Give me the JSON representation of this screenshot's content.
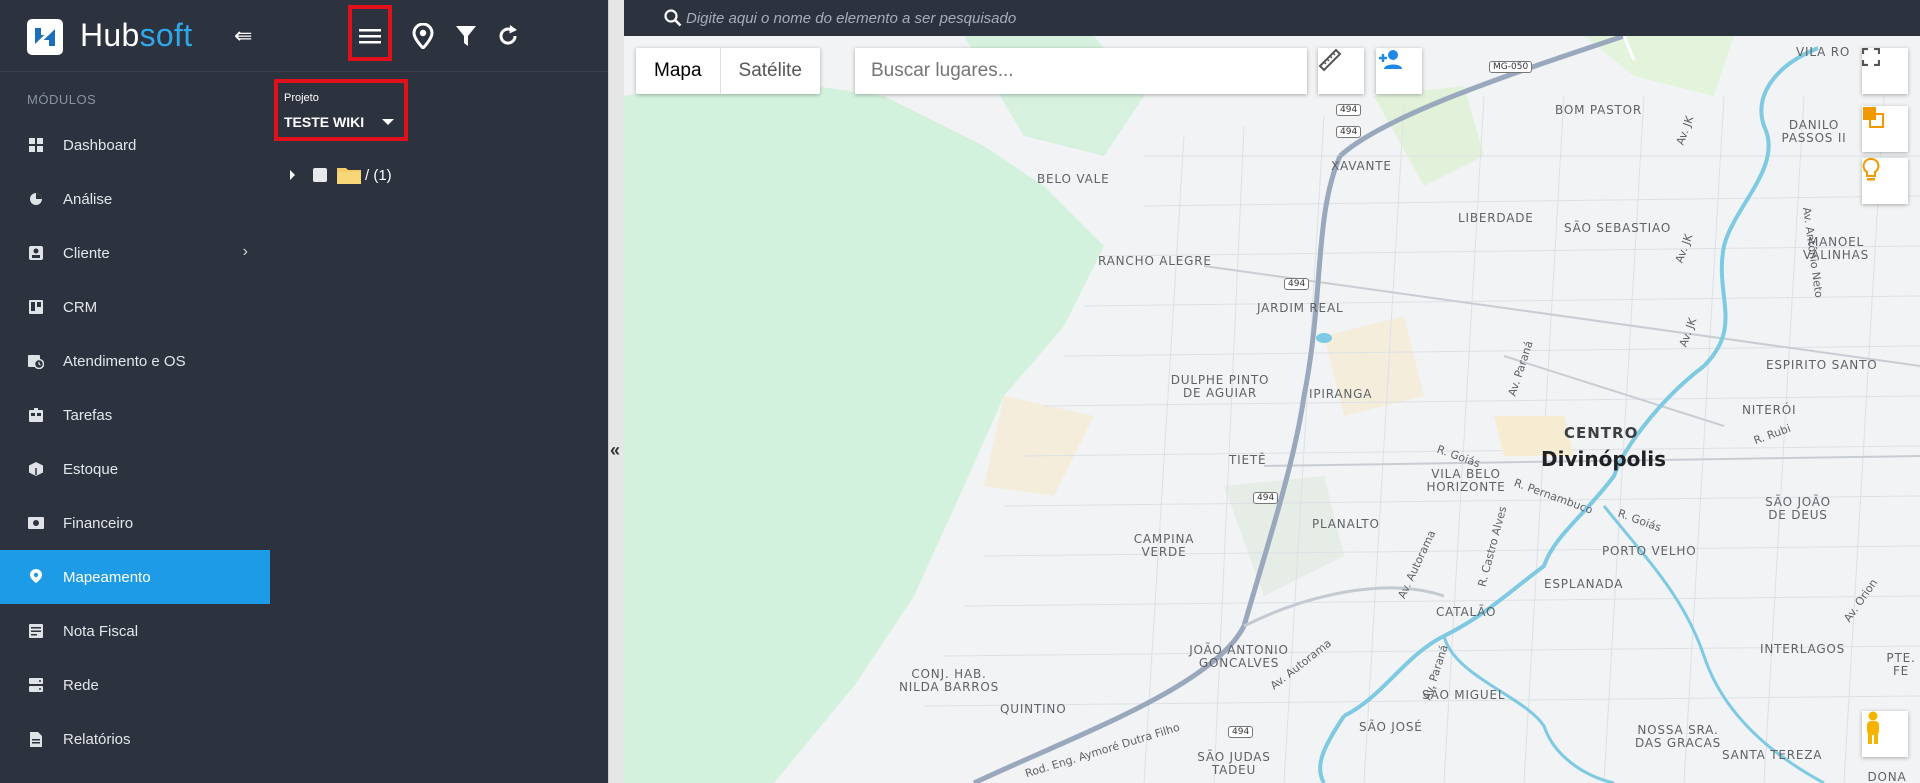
{
  "brand": {
    "hub": "Hub",
    "soft": "soft",
    "collapse_glyph": "⇚"
  },
  "sidebar": {
    "section_title": "MÓDULOS",
    "items": [
      {
        "label": "Dashboard",
        "icon": "dashboard-icon"
      },
      {
        "label": "Análise",
        "icon": "pie-chart-icon"
      },
      {
        "label": "Cliente",
        "icon": "contact-card-icon",
        "has_submenu": true
      },
      {
        "label": "CRM",
        "icon": "kanban-icon"
      },
      {
        "label": "Atendimento e OS",
        "icon": "calendar-clock-icon"
      },
      {
        "label": "Tarefas",
        "icon": "tasks-icon"
      },
      {
        "label": "Estoque",
        "icon": "box-icon"
      },
      {
        "label": "Financeiro",
        "icon": "money-icon"
      },
      {
        "label": "Mapeamento",
        "icon": "map-pin-icon",
        "active": true
      },
      {
        "label": "Nota Fiscal",
        "icon": "invoice-icon"
      },
      {
        "label": "Rede",
        "icon": "server-icon"
      },
      {
        "label": "Relatórios",
        "icon": "report-icon"
      }
    ]
  },
  "panel": {
    "toolbar": [
      "menu-icon",
      "map-marker-icon",
      "filter-icon",
      "refresh-icon"
    ],
    "project_label": "Projeto",
    "project_value": "TESTE WIKI",
    "tree_root": "/ (1)"
  },
  "topbar": {
    "search_placeholder": "Digite aqui o nome do elemento a ser pesquisado"
  },
  "map": {
    "type_map": "Mapa",
    "type_satellite": "Satélite",
    "search_placeholder": "Buscar lugares...",
    "city": "Divinópolis",
    "neighborhoods": [
      "VILA RO",
      "BOM PASTOR",
      "DANILO PASSOS II",
      "XAVANTE",
      "BELO VALE",
      "LIBERDADE",
      "SÃO SEBASTIAO",
      "MANOEL VALINHAS",
      "RANCHO ALEGRE",
      "JARDIM REAL",
      "ESPIRITO SANTO",
      "DULPHE PINTO DE AGUIAR",
      "IPIRANGA",
      "NITERÓI",
      "CENTRO",
      "TIETÊ",
      "VILA BELO HORIZONTE",
      "SÃO JOÃO DE DEUS",
      "PLANALTO",
      "CAMPINA VERDE",
      "PORTO VELHO",
      "ESPLANADA",
      "CATALÃO",
      "JOÃO ANTONIO GONCALVES",
      "INTERLAGOS",
      "PTE. FE",
      "CONJ. HAB. NILDA BARROS",
      "SÃO MIGUEL",
      "QUINTINO",
      "SÃO JOSÉ",
      "NOSSA SRA. DAS GRACAS",
      "SANTA TEREZA",
      "SÃO JUDAS TADEU",
      "DONA QUIT"
    ],
    "streets": [
      "Av. JK",
      "Av. Antônio Neto",
      "Av. Paraná",
      "R. Goiás",
      "R. Pernambuco",
      "R. Rubi",
      "Av. Autorama",
      "R. Castro Alves",
      "Av. Orion",
      "Rod. Eng. Aymoré Dutra Filho"
    ],
    "shields": [
      "MG-050",
      "494"
    ],
    "colors": {
      "water": "#7ecae3",
      "park": "#d3f2de",
      "road": "#9aa8bd",
      "accent": "#e0111b",
      "active": "#1e9be6"
    }
  }
}
